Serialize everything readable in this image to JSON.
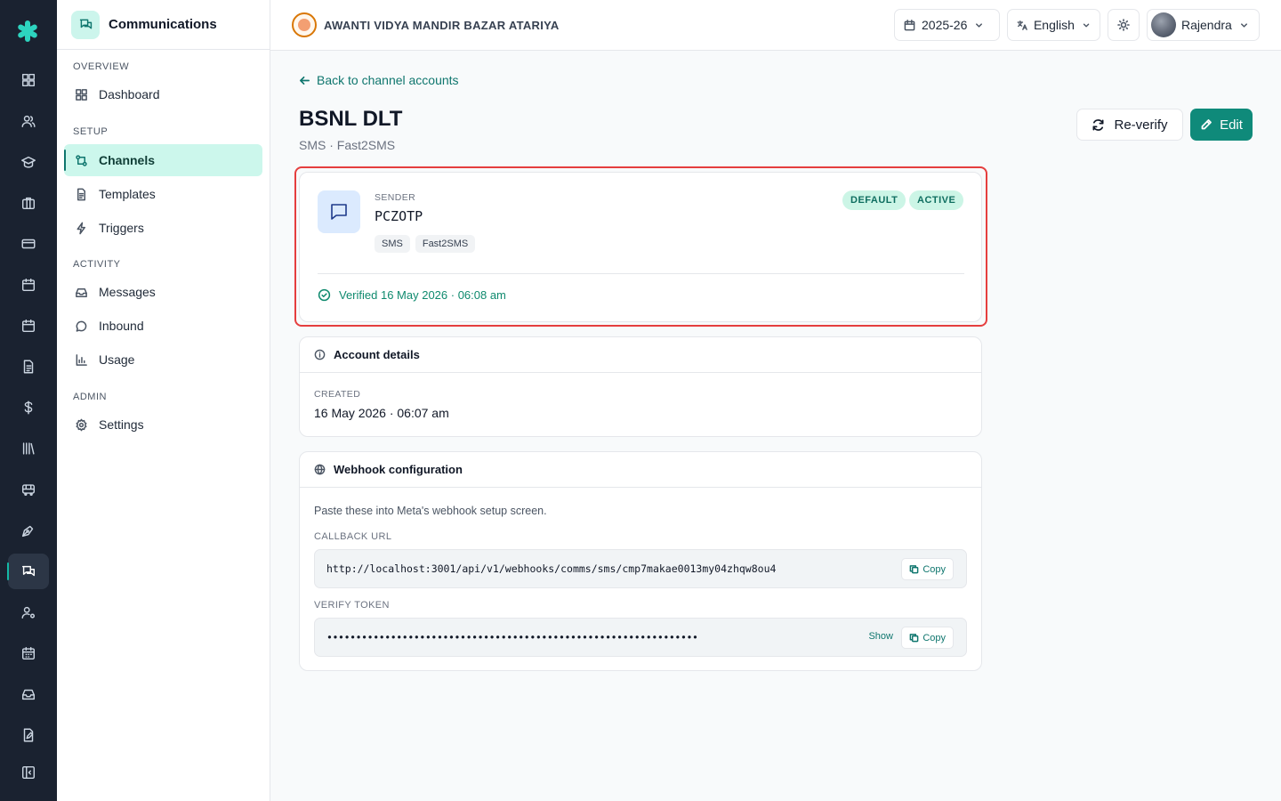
{
  "sidebar": {
    "title": "Communications",
    "sections": {
      "overview": "OVERVIEW",
      "setup": "SETUP",
      "activity": "ACTIVITY",
      "admin": "ADMIN"
    },
    "items": {
      "dashboard": "Dashboard",
      "channels": "Channels",
      "templates": "Templates",
      "triggers": "Triggers",
      "messages": "Messages",
      "inbound": "Inbound",
      "usage": "Usage",
      "settings": "Settings"
    }
  },
  "topbar": {
    "school_name": "AWANTI VIDYA MANDIR BAZAR ATARIYA",
    "year": "2025-26",
    "language": "English",
    "user": "Rajendra"
  },
  "page": {
    "back_link": "Back to channel accounts",
    "title": "BSNL DLT",
    "subtitle": "SMS · Fast2SMS",
    "reverify_label": "Re-verify",
    "edit_label": "Edit"
  },
  "sender_card": {
    "label": "SENDER",
    "value": "PCZOTP",
    "chips": [
      "SMS",
      "Fast2SMS"
    ],
    "badges": [
      "DEFAULT",
      "ACTIVE"
    ],
    "verified": "Verified 16 May 2026 · 06:08 am"
  },
  "account_details": {
    "heading": "Account details",
    "created_label": "CREATED",
    "created_value": "16 May 2026 · 06:07 am"
  },
  "webhook": {
    "heading": "Webhook configuration",
    "description": "Paste these into Meta's webhook setup screen.",
    "callback_label": "CALLBACK URL",
    "callback_value": "http://localhost:3001/api/v1/webhooks/comms/sms/cmp7makae0013my04zhqw8ou4",
    "token_label": "VERIFY TOKEN",
    "token_value": "••••••••••••••••••••••••••••••••••••••••••••••••••••••••••••••••",
    "show_label": "Show",
    "copy_label": "Copy"
  },
  "colors": {
    "accent": "#0f8a7a",
    "rail_bg": "#1a2230",
    "highlight": "#e53e3e"
  }
}
